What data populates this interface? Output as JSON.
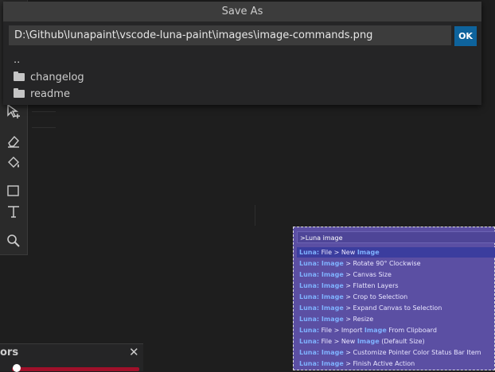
{
  "dialog": {
    "title": "Save As",
    "path_value": "D:\\Github\\lunapaint\\vscode-luna-paint\\images\\image-commands.png",
    "ok_label": "OK",
    "entries": [
      {
        "label": "..",
        "type": "parent"
      },
      {
        "label": "changelog",
        "type": "folder"
      },
      {
        "label": "readme",
        "type": "folder"
      }
    ]
  },
  "palette": {
    "input": ">Luna image",
    "items": [
      {
        "prefix": "Luna:",
        "parts": [
          " File > New ",
          "Image",
          ""
        ]
      },
      {
        "prefix": "Luna: ",
        "parts": [
          "",
          "Image",
          " > Rotate 90° Clockwise"
        ]
      },
      {
        "prefix": "Luna: ",
        "parts": [
          "",
          "Image",
          " > Canvas Size"
        ]
      },
      {
        "prefix": "Luna: ",
        "parts": [
          "",
          "Image",
          " > Flatten Layers"
        ]
      },
      {
        "prefix": "Luna: ",
        "parts": [
          "",
          "Image",
          " > Crop to Selection"
        ]
      },
      {
        "prefix": "Luna: ",
        "parts": [
          "",
          "Image",
          " > Expand Canvas to Selection"
        ]
      },
      {
        "prefix": "Luna: ",
        "parts": [
          "",
          "Image",
          " > Resize"
        ]
      },
      {
        "prefix": "Luna:",
        "parts": [
          " File > Import ",
          "Image",
          " From Clipboard"
        ]
      },
      {
        "prefix": "Luna:",
        "parts": [
          " File > New ",
          "Image",
          " (Default Size)"
        ]
      },
      {
        "prefix": "Luna: ",
        "parts": [
          "",
          "Image",
          " > Customize Pointer Color Status Bar Item"
        ]
      },
      {
        "prefix": "Luna: ",
        "parts": [
          "",
          "Image",
          " > Finish Active Action"
        ]
      }
    ]
  },
  "colors_panel": {
    "title": "ors",
    "close": "✕"
  },
  "colors": {
    "accent": "#0e639c",
    "palette_bg": "#5b4fa3",
    "highlight": "#7fb2ff"
  }
}
